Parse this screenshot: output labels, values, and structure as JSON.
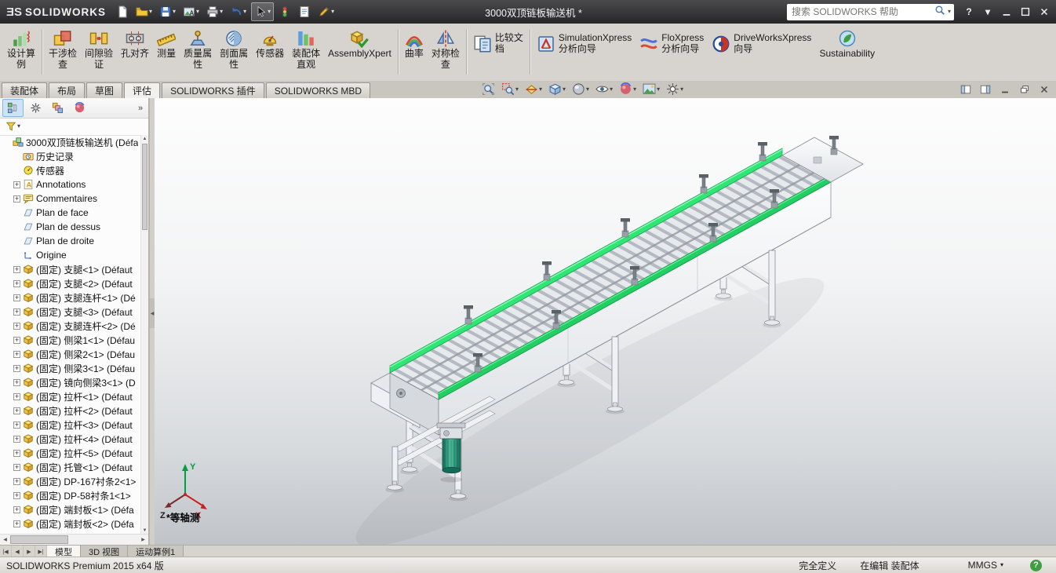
{
  "title_bar": {
    "logo_mark": "ƎS",
    "logo_text": "SOLIDWORKS",
    "document_title": "3000双顶链板输送机 *",
    "search_placeholder": "搜索 SOLIDWORKS 帮助",
    "toolbar": [
      {
        "name": "new-document-button",
        "icon": "new-doc",
        "dropdown": false
      },
      {
        "name": "open-button",
        "icon": "open-folder",
        "dropdown": true
      },
      {
        "name": "save-button",
        "icon": "save",
        "dropdown": true
      },
      {
        "name": "appearance-capture-button",
        "icon": "image-a",
        "dropdown": true
      },
      {
        "name": "print-button",
        "icon": "print",
        "dropdown": true
      },
      {
        "name": "undo-button",
        "icon": "undo",
        "dropdown": true
      },
      {
        "name": "select-button",
        "icon": "select-arrow",
        "dropdown": true,
        "pressed": true
      },
      {
        "name": "rebuild-button",
        "icon": "rebuild",
        "dropdown": false
      },
      {
        "name": "file-properties-button",
        "icon": "file-props",
        "dropdown": false
      },
      {
        "name": "options-edit-button",
        "icon": "edit",
        "dropdown": true
      }
    ],
    "window_controls": [
      {
        "name": "help-button",
        "icon": "help"
      },
      {
        "name": "help-dropdown",
        "icon": "dropdown"
      },
      {
        "name": "minimize-button",
        "icon": "win-min"
      },
      {
        "name": "maximize-button",
        "icon": "win-max"
      },
      {
        "name": "close-button",
        "icon": "win-close"
      }
    ]
  },
  "ribbon": {
    "buttons": [
      {
        "name": "design-study",
        "icon": "design-study",
        "label": [
          "设计算",
          "例"
        ]
      },
      {
        "name": "interference-check",
        "icon": "interference",
        "label": [
          "干涉检",
          "查"
        ]
      },
      {
        "name": "clearance-verify",
        "icon": "clearance",
        "label": [
          "间隙验",
          "证"
        ]
      },
      {
        "name": "hole-alignment",
        "icon": "hole-align",
        "label": [
          "孔对齐"
        ]
      },
      {
        "name": "measure",
        "icon": "measure",
        "label": [
          "测量"
        ]
      },
      {
        "name": "mass-properties",
        "icon": "mass-props",
        "label": [
          "质量属",
          "性"
        ]
      },
      {
        "name": "section-properties",
        "icon": "section-props",
        "label": [
          "剖面属",
          "性"
        ]
      },
      {
        "name": "sensor",
        "icon": "sensor",
        "label": [
          "传感器"
        ]
      },
      {
        "name": "assembly-visualization",
        "icon": "assembly-visual",
        "label": [
          "装配体",
          "直观"
        ]
      },
      {
        "name": "assemblyxpert",
        "icon": "assemblyxpert",
        "label": [
          "AssemblyXpert"
        ]
      },
      {
        "name": "curvature",
        "icon": "curvature",
        "label": [
          "曲率"
        ]
      },
      {
        "name": "symmetry-check",
        "icon": "symmetry",
        "label": [
          "对称检",
          "查"
        ]
      },
      {
        "name": "compare-documents",
        "icon": "compare",
        "label": [
          "比较文",
          "档"
        ],
        "wide": true
      },
      {
        "name": "simulationxpress-wizard",
        "icon": "simulationxpress",
        "label": [
          "SimulationXpress",
          "分析向导"
        ],
        "wide": true
      },
      {
        "name": "floxpress-wizard",
        "icon": "floxpress",
        "label": [
          "FloXpress",
          "分析向导"
        ],
        "wide": true
      },
      {
        "name": "driveworksxpress-wizard",
        "icon": "driveworks",
        "label": [
          "DriveWorksXpress",
          "向导"
        ],
        "wide": true
      },
      {
        "name": "sustainability",
        "icon": "sustainability",
        "label": [
          "Sustainability"
        ]
      }
    ],
    "separators_after": [
      0,
      9,
      11,
      12
    ]
  },
  "command_tabs": [
    {
      "name": "tab-assembly",
      "label": "装配体"
    },
    {
      "name": "tab-layout",
      "label": "布局"
    },
    {
      "name": "tab-sketch",
      "label": "草图"
    },
    {
      "name": "tab-evaluate",
      "label": "评估",
      "active": true
    },
    {
      "name": "tab-solidworks-addins",
      "label": "SOLIDWORKS 插件"
    },
    {
      "name": "tab-solidworks-mbd",
      "label": "SOLIDWORKS MBD"
    }
  ],
  "headsup": [
    {
      "name": "zoom-fit-button",
      "icon": "zoom-fit",
      "dropdown": false
    },
    {
      "name": "zoom-area-button",
      "icon": "zoom-area",
      "dropdown": true
    },
    {
      "name": "section-view-button",
      "icon": "section-view",
      "dropdown": true
    },
    {
      "name": "view-orientation-button",
      "icon": "view-orientation",
      "dropdown": true
    },
    {
      "name": "display-style-button",
      "icon": "display-style",
      "dropdown": true
    },
    {
      "name": "hide-show-items-button",
      "icon": "hide-show",
      "dropdown": true
    },
    {
      "name": "edit-appearance-button",
      "icon": "edit-appearance",
      "dropdown": true
    },
    {
      "name": "apply-scene-button",
      "icon": "apply-scene",
      "dropdown": true
    },
    {
      "name": "view-settings-button",
      "icon": "view-settings",
      "dropdown": true
    }
  ],
  "doc_controls": [
    {
      "name": "pane-left-toggle",
      "icon": "pane-left"
    },
    {
      "name": "pane-right-toggle",
      "icon": "pane-right"
    },
    {
      "name": "doc-minimize-button",
      "icon": "doc-min"
    },
    {
      "name": "doc-restore-button",
      "icon": "doc-restore"
    },
    {
      "name": "doc-close-button",
      "icon": "doc-close"
    }
  ],
  "feature_tree": {
    "header_tabs": [
      {
        "name": "featuremanager-tab",
        "icon": "featuremanager",
        "active": true
      },
      {
        "name": "propertymanager-tab",
        "icon": "propertymanager"
      },
      {
        "name": "configurationmanager-tab",
        "icon": "configurationmanager"
      },
      {
        "name": "displaymanager-tab",
        "icon": "displaymanager"
      },
      {
        "name": "tree-tabs-overflow",
        "icon": "chevrons",
        "overflow": true
      }
    ],
    "filter": {
      "name": "filter-button",
      "icon": "funnel"
    },
    "root": {
      "label": "3000双顶链板输送机 (Défa",
      "icon": "assembly"
    },
    "items": [
      {
        "label": "历史记录",
        "icon": "history"
      },
      {
        "label": "传感器",
        "icon": "sensors"
      },
      {
        "label": "Annotations",
        "icon": "annotations",
        "expandable": true
      },
      {
        "label": "Commentaires",
        "icon": "comments",
        "expandable": true
      },
      {
        "label": "Plan de face",
        "icon": "plane"
      },
      {
        "label": "Plan de dessus",
        "icon": "plane"
      },
      {
        "label": "Plan de droite",
        "icon": "plane"
      },
      {
        "label": "Origine",
        "icon": "origin"
      },
      {
        "label": "(固定) 支腿<1> (Défaut",
        "icon": "part",
        "expandable": true
      },
      {
        "label": "(固定) 支腿<2> (Défaut",
        "icon": "part",
        "expandable": true
      },
      {
        "label": "(固定) 支腿连杆<1> (Dé",
        "icon": "part",
        "expandable": true
      },
      {
        "label": "(固定) 支腿<3> (Défaut",
        "icon": "part",
        "expandable": true
      },
      {
        "label": "(固定) 支腿连杆<2> (Dé",
        "icon": "part",
        "expandable": true
      },
      {
        "label": "(固定) 侧梁1<1> (Défau",
        "icon": "part",
        "expandable": true
      },
      {
        "label": "(固定) 侧梁2<1> (Défau",
        "icon": "part",
        "expandable": true
      },
      {
        "label": "(固定) 侧梁3<1> (Défau",
        "icon": "part",
        "expandable": true
      },
      {
        "label": "(固定) 镜向侧梁3<1> (D",
        "icon": "part",
        "expandable": true
      },
      {
        "label": "(固定) 拉杆<1> (Défaut",
        "icon": "part",
        "expandable": true
      },
      {
        "label": "(固定) 拉杆<2> (Défaut",
        "icon": "part",
        "expandable": true
      },
      {
        "label": "(固定) 拉杆<3> (Défaut",
        "icon": "part",
        "expandable": true
      },
      {
        "label": "(固定) 拉杆<4> (Défaut",
        "icon": "part",
        "expandable": true
      },
      {
        "label": "(固定) 拉杆<5> (Défaut",
        "icon": "part",
        "expandable": true
      },
      {
        "label": "(固定) 托管<1> (Défaut",
        "icon": "part",
        "expandable": true
      },
      {
        "label": "(固定) DP-167衬条2<1>",
        "icon": "part",
        "expandable": true
      },
      {
        "label": "(固定) DP-58衬条1<1>",
        "icon": "part",
        "expandable": true
      },
      {
        "label": "(固定) 端封板<1> (Défa",
        "icon": "part",
        "expandable": true
      },
      {
        "label": "(固定) 端封板<2> (Défa",
        "icon": "part",
        "expandable": true
      }
    ]
  },
  "viewport": {
    "view_label": "*等轴测",
    "triad": {
      "x": "X",
      "y": "Y",
      "z": "Z"
    }
  },
  "bottom_bar": {
    "nav_icons": [
      {
        "name": "scroll-first-button",
        "icon": "first"
      },
      {
        "name": "scroll-left-button",
        "icon": "left"
      },
      {
        "name": "scroll-right-button",
        "icon": "right"
      },
      {
        "name": "scroll-last-button",
        "icon": "last"
      }
    ],
    "tabs": [
      {
        "name": "tab-model",
        "label": "模型",
        "active": true
      },
      {
        "name": "tab-3d-views",
        "label": "3D 视图"
      },
      {
        "name": "tab-motion-study",
        "label": "运动算例1"
      }
    ]
  },
  "status_bar": {
    "left": "SOLIDWORKS Premium 2015 x64 版",
    "defined": "完全定义",
    "editing": "在编辑 装配体",
    "units": "MMGS"
  }
}
